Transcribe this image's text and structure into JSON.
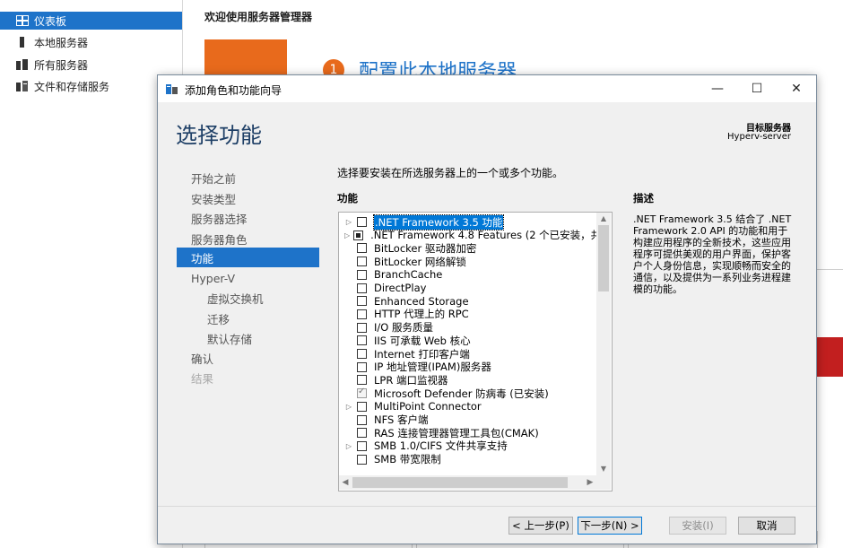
{
  "background": {
    "sidebar": {
      "items": [
        {
          "label": "仪表板",
          "icon": "dashboard-icon",
          "active": true
        },
        {
          "label": "本地服务器",
          "icon": "server-icon",
          "active": false
        },
        {
          "label": "所有服务器",
          "icon": "servers-icon",
          "active": false
        },
        {
          "label": "文件和存储服务",
          "icon": "storage-icon",
          "active": false
        }
      ]
    },
    "welcome_title": "欢迎使用服务器管理器",
    "step_number": "1",
    "step_title": "配置此本地服务器"
  },
  "wizard": {
    "title": "添加角色和功能向导",
    "page_title": "选择功能",
    "target_label": "目标服务器",
    "target_name": "Hyperv-server",
    "steps": [
      {
        "label": "开始之前",
        "state": "normal",
        "sub": false
      },
      {
        "label": "安装类型",
        "state": "normal",
        "sub": false
      },
      {
        "label": "服务器选择",
        "state": "normal",
        "sub": false
      },
      {
        "label": "服务器角色",
        "state": "normal",
        "sub": false
      },
      {
        "label": "功能",
        "state": "active",
        "sub": false
      },
      {
        "label": "Hyper-V",
        "state": "normal",
        "sub": false
      },
      {
        "label": "虚拟交换机",
        "state": "normal",
        "sub": true
      },
      {
        "label": "迁移",
        "state": "normal",
        "sub": true
      },
      {
        "label": "默认存储",
        "state": "normal",
        "sub": true
      },
      {
        "label": "确认",
        "state": "normal",
        "sub": false
      },
      {
        "label": "结果",
        "state": "disabled",
        "sub": false
      }
    ],
    "instruction": "选择要安装在所选服务器上的一个或多个功能。",
    "features_header": "功能",
    "description_header": "描述",
    "features": [
      {
        "label": ".NET Framework 3.5 功能",
        "expandable": true,
        "state": "unchecked",
        "selected": true
      },
      {
        "label": ".NET Framework 4.8 Features (2 个已安装，共 7",
        "expandable": true,
        "state": "partial",
        "selected": false
      },
      {
        "label": "BitLocker 驱动器加密",
        "expandable": false,
        "state": "unchecked",
        "selected": false
      },
      {
        "label": "BitLocker 网络解锁",
        "expandable": false,
        "state": "unchecked",
        "selected": false
      },
      {
        "label": "BranchCache",
        "expandable": false,
        "state": "unchecked",
        "selected": false
      },
      {
        "label": "DirectPlay",
        "expandable": false,
        "state": "unchecked",
        "selected": false
      },
      {
        "label": "Enhanced Storage",
        "expandable": false,
        "state": "unchecked",
        "selected": false
      },
      {
        "label": "HTTP 代理上的 RPC",
        "expandable": false,
        "state": "unchecked",
        "selected": false
      },
      {
        "label": "I/O 服务质量",
        "expandable": false,
        "state": "unchecked",
        "selected": false
      },
      {
        "label": "IIS 可承载 Web 核心",
        "expandable": false,
        "state": "unchecked",
        "selected": false
      },
      {
        "label": "Internet 打印客户端",
        "expandable": false,
        "state": "unchecked",
        "selected": false
      },
      {
        "label": "IP 地址管理(IPAM)服务器",
        "expandable": false,
        "state": "unchecked",
        "selected": false
      },
      {
        "label": "LPR 端口监视器",
        "expandable": false,
        "state": "unchecked",
        "selected": false
      },
      {
        "label": "Microsoft Defender 防病毒 (已安装)",
        "expandable": false,
        "state": "checked",
        "selected": false
      },
      {
        "label": "MultiPoint Connector",
        "expandable": true,
        "state": "unchecked",
        "selected": false
      },
      {
        "label": "NFS 客户端",
        "expandable": false,
        "state": "unchecked",
        "selected": false
      },
      {
        "label": "RAS 连接管理器管理工具包(CMAK)",
        "expandable": false,
        "state": "unchecked",
        "selected": false
      },
      {
        "label": "SMB 1.0/CIFS 文件共享支持",
        "expandable": true,
        "state": "unchecked",
        "selected": false
      },
      {
        "label": "SMB 带宽限制",
        "expandable": false,
        "state": "unchecked",
        "selected": false
      }
    ],
    "description": ".NET Framework 3.5 结合了 .NET Framework 2.0 API 的功能和用于构建应用程序的全新技术，这些应用程序可提供美观的用户界面，保护客户个人身份信息，实现顺畅而安全的通信，以及提供为一系列业务进程建模的功能。",
    "buttons": {
      "previous": "< 上一步(P)",
      "next": "下一步(N) >",
      "install": "安装(I)",
      "cancel": "取消"
    },
    "window_controls": {
      "minimize": "—",
      "maximize": "☐",
      "close": "✕"
    }
  },
  "colors": {
    "accent": "#1e73c9",
    "orange": "#e86a1c",
    "selection": "#0078d7",
    "alert_red": "#c21f1f"
  }
}
